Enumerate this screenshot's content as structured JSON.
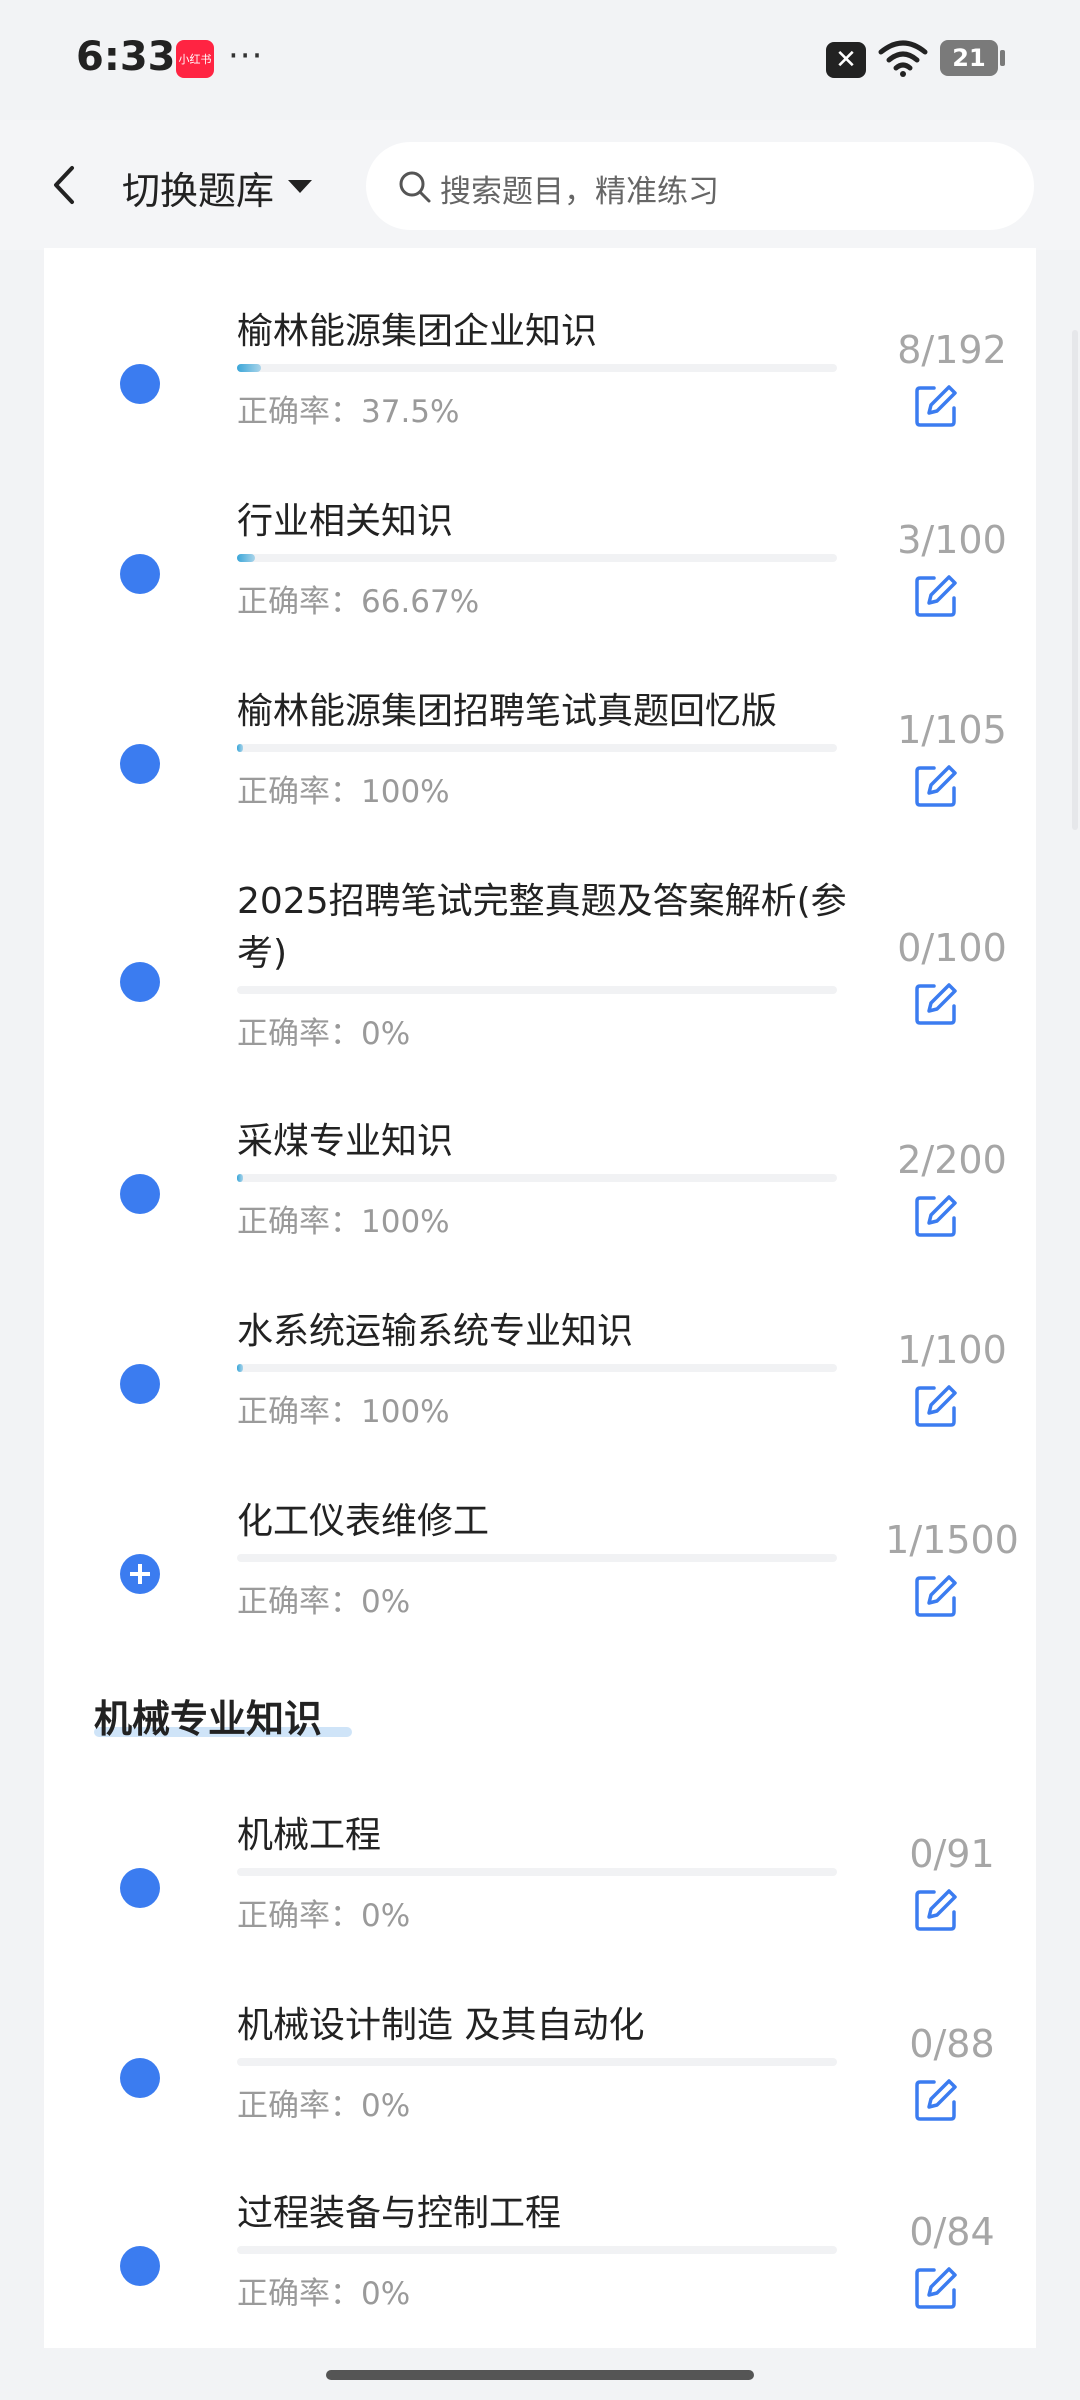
{
  "status_bar": {
    "time": "6:33",
    "app_badge": "小红书",
    "dots": "···",
    "battery": "21"
  },
  "header": {
    "back_label": "",
    "title": "切换题库",
    "search_placeholder": "搜索题目，精准练习"
  },
  "rate_label": "正确率：",
  "items": [
    {
      "title": "榆林能源集团企业知识",
      "count": "8/192",
      "rate": "37.5%",
      "progress": 0.04,
      "marker": "dot"
    },
    {
      "title": "行业相关知识",
      "count": "3/100",
      "rate": "66.67%",
      "progress": 0.03,
      "marker": "dot"
    },
    {
      "title": "榆林能源集团招聘笔试真题回忆版",
      "count": "1/105",
      "rate": "100%",
      "progress": 0.01,
      "marker": "dot"
    },
    {
      "title": "2025招聘笔试完整真题及答案解析(参考)",
      "count": "0/100",
      "rate": "0%",
      "progress": 0,
      "marker": "dot"
    },
    {
      "title": "采煤专业知识",
      "count": "2/200",
      "rate": "100%",
      "progress": 0.01,
      "marker": "dot"
    },
    {
      "title": "水系统运输系统专业知识",
      "count": "1/100",
      "rate": "100%",
      "progress": 0.01,
      "marker": "dot"
    },
    {
      "title": "化工仪表维修工",
      "count": "1/1500",
      "rate": "0%",
      "progress": 0,
      "marker": "plus"
    }
  ],
  "section": {
    "title": "机械专业知识"
  },
  "section_items": [
    {
      "title": "机械工程",
      "count": "0/91",
      "rate": "0%",
      "progress": 0,
      "marker": "dot"
    },
    {
      "title": "机械设计制造 及其自动化",
      "count": "0/88",
      "rate": "0%",
      "progress": 0,
      "marker": "dot"
    },
    {
      "title": "过程装备与控制工程",
      "count": "0/84",
      "rate": "0%",
      "progress": 0,
      "marker": "dot"
    }
  ],
  "colors": {
    "accent": "#3b7cf0",
    "progress": "#3aa6d8",
    "muted": "#9a9a9a"
  },
  "icons": {
    "edit": "edit-icon",
    "back": "chevron-left-icon",
    "search": "search-icon"
  }
}
